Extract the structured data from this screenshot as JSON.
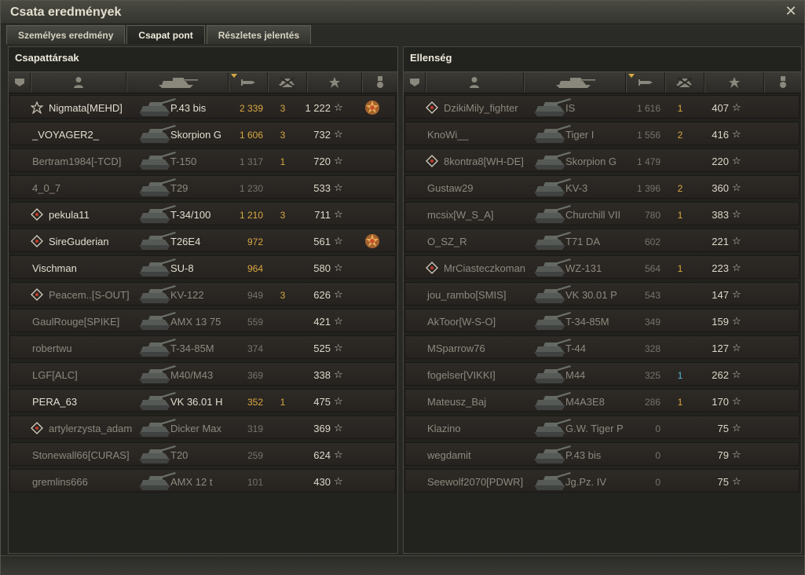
{
  "window": {
    "title": "Csata eredmények"
  },
  "tabs": [
    {
      "label": "Személyes eredmény",
      "active": false
    },
    {
      "label": "Csapat pont",
      "active": true
    },
    {
      "label": "Részletes jelentés",
      "active": false
    }
  ],
  "colors": {
    "gold": "#d9a940",
    "blue": "#56b9d0",
    "alive_text": "#e2ded0",
    "dead_text": "#8d897e"
  },
  "left": {
    "title": "Csapattársak",
    "rows": [
      {
        "player": "Nigmata[MEHD]",
        "icon": "star-rank-icon",
        "tank": "P.43 bis",
        "dmg": "2 339",
        "dmg_hi": true,
        "kills": "3",
        "xp": "1 222",
        "medal": true,
        "alive": true
      },
      {
        "player": "_VOYAGER2_",
        "icon": "",
        "tank": "Skorpion G",
        "dmg": "1 606",
        "dmg_hi": true,
        "kills": "3",
        "xp": "732",
        "medal": false,
        "alive": true
      },
      {
        "player": "Bertram1984[-TCD]",
        "icon": "",
        "tank": "T-150",
        "dmg": "1 317",
        "dmg_hi": false,
        "kills": "1",
        "xp": "720",
        "medal": false,
        "alive": false
      },
      {
        "player": "4_0_7",
        "icon": "",
        "tank": "T29",
        "dmg": "1 230",
        "dmg_hi": false,
        "kills": "",
        "xp": "533",
        "medal": false,
        "alive": false
      },
      {
        "player": "pekula11",
        "icon": "diamond-rank-icon",
        "tank": "T-34/100",
        "dmg": "1 210",
        "dmg_hi": true,
        "kills": "3",
        "xp": "711",
        "medal": false,
        "alive": true
      },
      {
        "player": "SireGuderian",
        "icon": "diamond-rank-icon",
        "tank": "T26E4",
        "dmg": "972",
        "dmg_hi": true,
        "kills": "",
        "xp": "561",
        "medal": true,
        "alive": true
      },
      {
        "player": "Vischman",
        "icon": "",
        "tank": "SU-8",
        "dmg": "964",
        "dmg_hi": true,
        "kills": "",
        "xp": "580",
        "medal": false,
        "alive": true
      },
      {
        "player": "Peacem..[S-OUT]",
        "icon": "diamond-rank-icon",
        "tank": "KV-122",
        "dmg": "949",
        "dmg_hi": false,
        "kills": "3",
        "xp": "626",
        "medal": false,
        "alive": false
      },
      {
        "player": "GaulRouge[SPIKE]",
        "icon": "",
        "tank": "AMX 13 75",
        "dmg": "559",
        "dmg_hi": false,
        "kills": "",
        "xp": "421",
        "medal": false,
        "alive": false
      },
      {
        "player": "robertwu",
        "icon": "",
        "tank": "T-34-85M",
        "dmg": "374",
        "dmg_hi": false,
        "kills": "",
        "xp": "525",
        "medal": false,
        "alive": false
      },
      {
        "player": "LGF[ALC]",
        "icon": "",
        "tank": "M40/M43",
        "dmg": "369",
        "dmg_hi": false,
        "kills": "",
        "xp": "338",
        "medal": false,
        "alive": false
      },
      {
        "player": "PERA_63",
        "icon": "",
        "tank": "VK 36.01 H",
        "dmg": "352",
        "dmg_hi": true,
        "kills": "1",
        "xp": "475",
        "medal": false,
        "alive": true
      },
      {
        "player": "artylerzysta_adam",
        "icon": "diamond-rank-icon",
        "tank": "Dicker Max",
        "dmg": "319",
        "dmg_hi": false,
        "kills": "",
        "xp": "369",
        "medal": false,
        "alive": false
      },
      {
        "player": "Stonewall66[CURAS]",
        "icon": "",
        "tank": "T20",
        "dmg": "259",
        "dmg_hi": false,
        "kills": "",
        "xp": "624",
        "medal": false,
        "alive": false
      },
      {
        "player": "gremlins666",
        "icon": "",
        "tank": "AMX 12 t",
        "dmg": "101",
        "dmg_hi": false,
        "kills": "",
        "xp": "430",
        "medal": false,
        "alive": false
      }
    ]
  },
  "right": {
    "title": "Ellenség",
    "rows": [
      {
        "player": "DzikiMily_fighter",
        "icon": "diamond-rank-icon",
        "tank": "IS",
        "dmg": "1 616",
        "kills": "1",
        "kills_blue": false,
        "xp": "407",
        "alive": false
      },
      {
        "player": "KnoWi__",
        "icon": "",
        "tank": "Tiger I",
        "dmg": "1 556",
        "kills": "2",
        "kills_blue": false,
        "xp": "416",
        "alive": false
      },
      {
        "player": "8kontra8[WH-DE]",
        "icon": "diamond-rank-icon",
        "tank": "Skorpion G",
        "dmg": "1 479",
        "kills": "",
        "kills_blue": false,
        "xp": "220",
        "alive": false
      },
      {
        "player": "Gustaw29",
        "icon": "",
        "tank": "KV-3",
        "dmg": "1 396",
        "kills": "2",
        "kills_blue": false,
        "xp": "360",
        "alive": false
      },
      {
        "player": "mcsix[W_S_A]",
        "icon": "",
        "tank": "Churchill VII",
        "dmg": "780",
        "kills": "1",
        "kills_blue": false,
        "xp": "383",
        "alive": false
      },
      {
        "player": "O_SZ_R",
        "icon": "",
        "tank": "T71 DA",
        "dmg": "602",
        "kills": "",
        "kills_blue": false,
        "xp": "221",
        "alive": false
      },
      {
        "player": "MrCiasteczkoman",
        "icon": "diamond-rank-icon",
        "tank": "WZ-131",
        "dmg": "564",
        "kills": "1",
        "kills_blue": false,
        "xp": "223",
        "alive": false
      },
      {
        "player": "jou_rambo[SMIS]",
        "icon": "",
        "tank": "VK 30.01 P",
        "dmg": "543",
        "kills": "",
        "kills_blue": false,
        "xp": "147",
        "alive": false
      },
      {
        "player": "AkToor[W-S-O]",
        "icon": "",
        "tank": "T-34-85M",
        "dmg": "349",
        "kills": "",
        "kills_blue": false,
        "xp": "159",
        "alive": false
      },
      {
        "player": "MSparrow76",
        "icon": "",
        "tank": "T-44",
        "dmg": "328",
        "kills": "",
        "kills_blue": false,
        "xp": "127",
        "alive": false
      },
      {
        "player": "fogelser[VIKKI]",
        "icon": "",
        "tank": "M44",
        "dmg": "325",
        "kills": "1",
        "kills_blue": true,
        "xp": "262",
        "alive": false
      },
      {
        "player": "Mateusz_Baj",
        "icon": "",
        "tank": "M4A3E8",
        "dmg": "286",
        "kills": "1",
        "kills_blue": false,
        "xp": "170",
        "alive": false
      },
      {
        "player": "Klazino",
        "icon": "",
        "tank": "G.W. Tiger P",
        "dmg": "0",
        "kills": "",
        "kills_blue": false,
        "xp": "75",
        "alive": false
      },
      {
        "player": "wegdamit",
        "icon": "",
        "tank": "P.43 bis",
        "dmg": "0",
        "kills": "",
        "kills_blue": false,
        "xp": "79",
        "alive": false
      },
      {
        "player": "Seewolf2070[PDWR]",
        "icon": "",
        "tank": "Jg.Pz. IV",
        "dmg": "0",
        "kills": "",
        "kills_blue": false,
        "xp": "75",
        "alive": false
      }
    ]
  }
}
